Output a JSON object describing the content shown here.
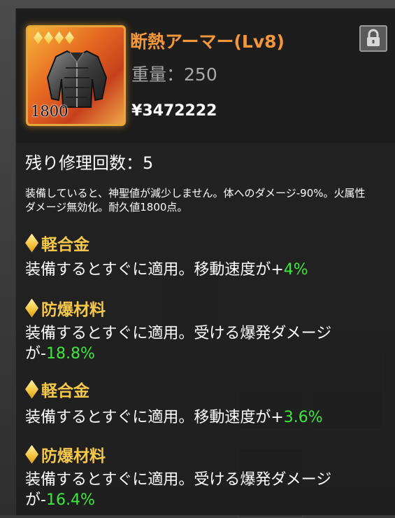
{
  "item": {
    "name": "断熱アーマー(Lv8)",
    "weight_label": "重量：",
    "weight_value": "250",
    "price_symbol": "¥",
    "price": "3472222",
    "durability": "1800",
    "rarity_stars": 4,
    "icon": "armor-jacket-icon"
  },
  "lock": {
    "icon": "lock-icon"
  },
  "repair": {
    "label": "残り修理回数：",
    "count": "5"
  },
  "description": "装備していると、神聖値が減少しません。体へのダメージ-90%。火属性ダメージ無効化。耐久値1800点。",
  "effects": [
    {
      "title": "軽合金",
      "text": "装備するとすぐに適用。移動速度が",
      "sign": "+",
      "value": "4%"
    },
    {
      "title": "防爆材料",
      "text": "装備するとすぐに適用。受ける爆発ダメージが",
      "sign": "-",
      "value": "18.8%"
    },
    {
      "title": "軽合金",
      "text": "装備するとすぐに適用。移動速度が",
      "sign": "+",
      "value": "3.6%"
    },
    {
      "title": "防爆材料",
      "text": "装備するとすぐに適用。受ける爆発ダメージが",
      "sign": "-",
      "value": "16.4%"
    }
  ],
  "colors": {
    "name": "#f2973a",
    "effect_title": "#f5c84a",
    "positive_value": "#3ee63e",
    "frame": "#e7a63a"
  }
}
